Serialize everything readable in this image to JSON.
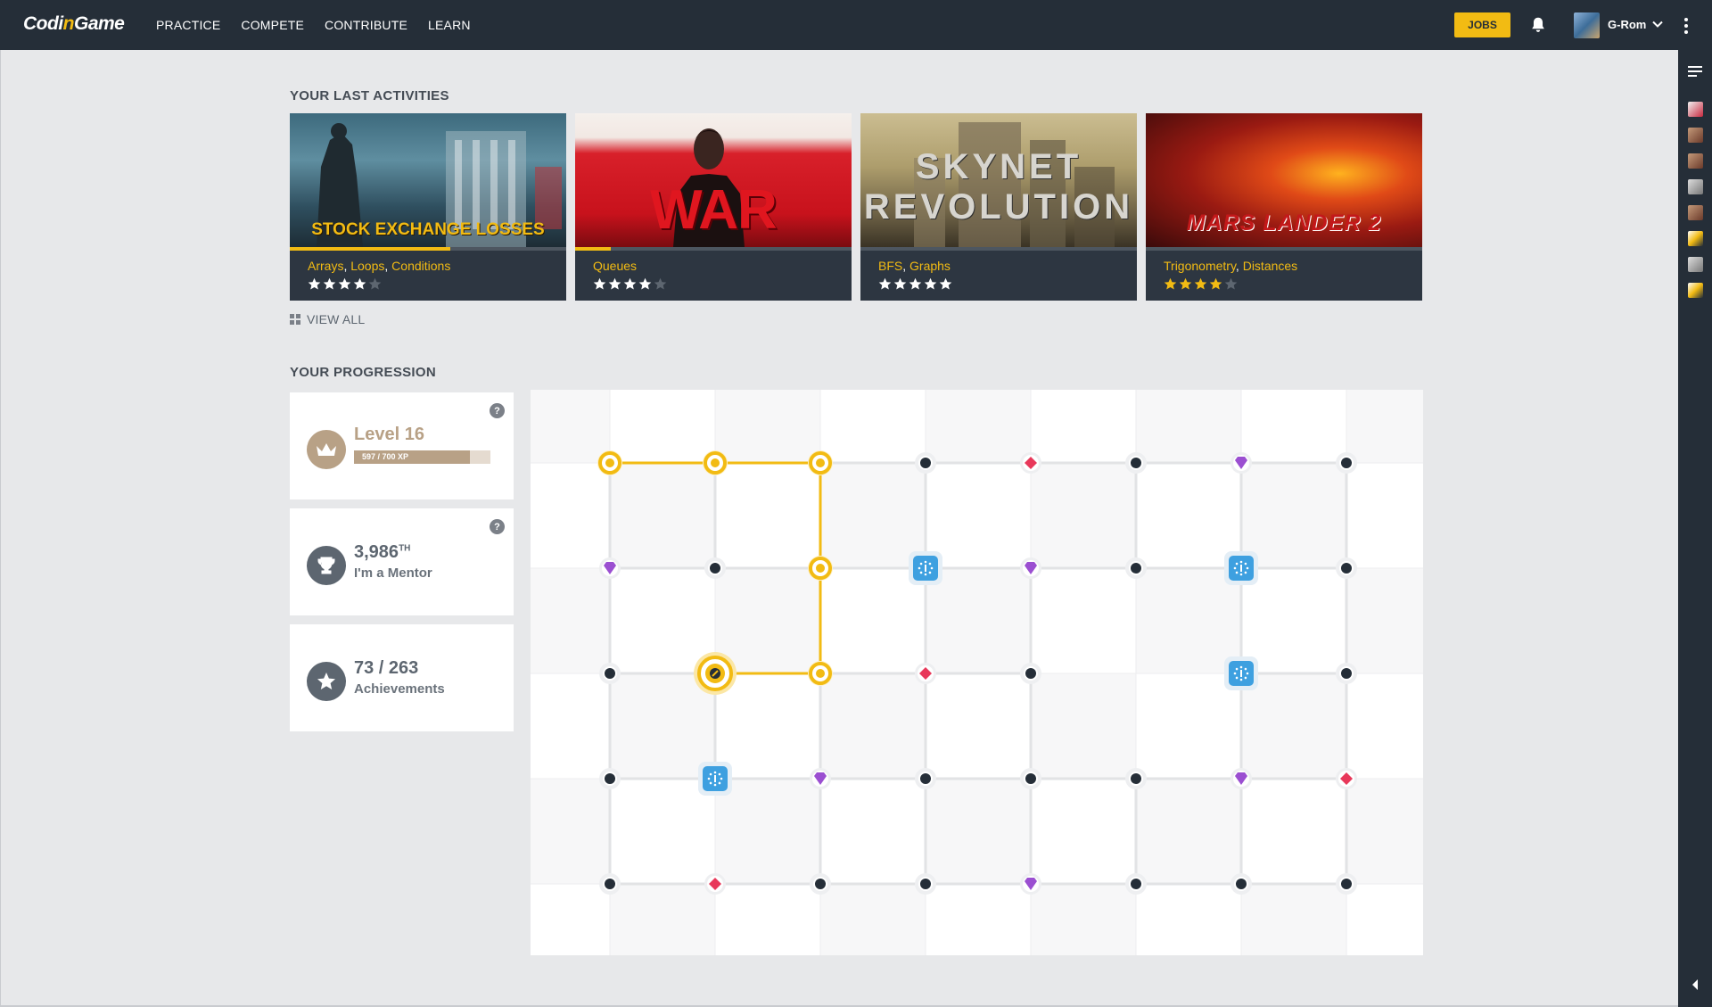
{
  "header": {
    "logo": {
      "main": "Codi",
      "accent": "n",
      "tail": "Game"
    },
    "nav": [
      "PRACTICE",
      "COMPETE",
      "CONTRIBUTE",
      "LEARN"
    ],
    "jobs_label": "JOBS",
    "username": "G-Rom",
    "icons": [
      "bell-icon",
      "chevron-down-icon",
      "kebab-menu-icon"
    ]
  },
  "activities": {
    "title": "YOUR LAST ACTIVITIES",
    "view_all": "VIEW ALL",
    "cards": [
      {
        "image_title": "STOCK EXCHANGE LOSSES",
        "tags": [
          "Arrays",
          "Loops",
          "Conditions"
        ],
        "rating": 4,
        "progress": 0.58
      },
      {
        "image_title": "WAR",
        "tags": [
          "Queues"
        ],
        "rating": 4,
        "progress": 0.13
      },
      {
        "image_title": "SKYNET REVOLUTION",
        "tags": [
          "BFS",
          "Graphs"
        ],
        "rating": 5,
        "progress": 0
      },
      {
        "image_title": "MARS LANDER 2",
        "tags": [
          "Trigonometry",
          "Distances"
        ],
        "rating": 4,
        "progress": 0
      }
    ]
  },
  "progression": {
    "title": "YOUR PROGRESSION",
    "level": {
      "label": "Level 16",
      "xp_text": "597 / 700 XP",
      "xp_current": 597,
      "xp_max": 700
    },
    "rank": {
      "value": "3,986",
      "suffix": "TH",
      "label": "I'm a Mentor"
    },
    "achievements": {
      "value": "73 / 263",
      "label": "Achievements"
    },
    "help_glyph": "?"
  },
  "colors": {
    "accent": "#f2bb13",
    "nav_bg": "#252e38",
    "level": "#b8a186",
    "node_dark": "#252e38",
    "node_gem_red": "#e8385a",
    "node_gem_purple": "#9b4fd1",
    "node_blue": "#3ea0e0"
  },
  "map": {
    "nodes": [
      [
        "gold",
        "gold",
        "gold",
        "dark",
        "red",
        "dark",
        "purple",
        "dark"
      ],
      [
        "purple",
        "dark",
        "gold",
        "blue",
        "purple",
        "dark",
        "blue",
        "dark"
      ],
      [
        "dark",
        "current",
        "gold",
        "red",
        "dark",
        "",
        "blue",
        "dark"
      ],
      [
        "dark",
        "blue",
        "purple",
        "dark",
        "dark",
        "dark",
        "purple",
        "red"
      ],
      [
        "dark",
        "red",
        "dark",
        "dark",
        "purple",
        "dark",
        "dark",
        "dark"
      ]
    ]
  }
}
